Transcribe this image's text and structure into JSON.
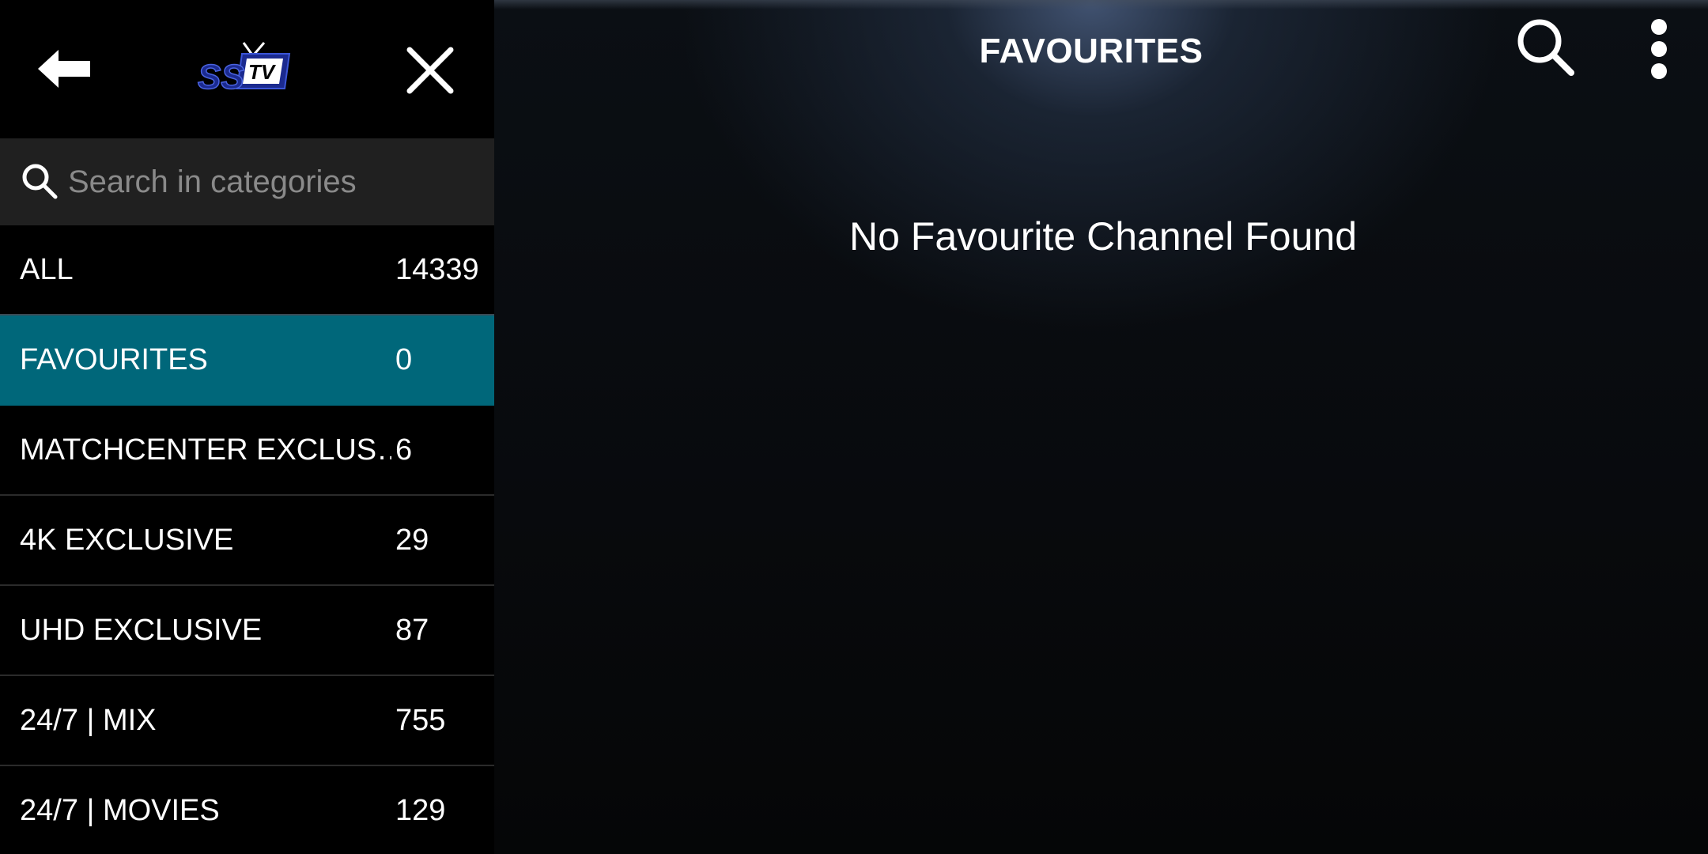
{
  "header": {
    "back_icon": "arrow-left-icon",
    "logo_text": "SSTV",
    "close_icon": "close-icon"
  },
  "search": {
    "placeholder": "Search in categories",
    "icon": "search-icon"
  },
  "categories": [
    {
      "name": "ALL",
      "count": "14339"
    },
    {
      "name": "FAVOURITES",
      "count": "0",
      "active": true
    },
    {
      "name": "MATCHCENTER EXCLUS…",
      "count": "6"
    },
    {
      "name": "4K EXCLUSIVE",
      "count": "29"
    },
    {
      "name": "UHD EXCLUSIVE",
      "count": "87"
    },
    {
      "name": "24/7 | MIX",
      "count": "755"
    },
    {
      "name": "24/7 | MOVIES",
      "count": "129"
    }
  ],
  "main": {
    "title": "FAVOURITES",
    "empty_message": "No Favourite Channel Found",
    "search_icon": "search-icon",
    "more_icon": "more-vertical-icon"
  },
  "colors": {
    "active_category": "#00677a",
    "search_bg": "#202020",
    "logo_blue": "#1b2a8f"
  }
}
